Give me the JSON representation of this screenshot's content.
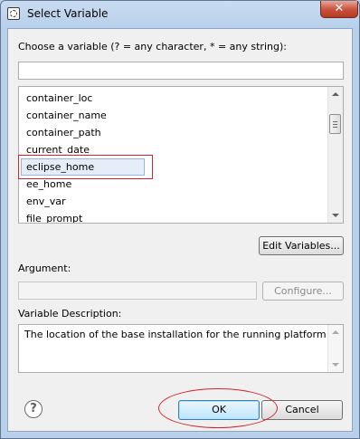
{
  "window": {
    "title": "Select Variable",
    "close_symbol": "✕"
  },
  "filter": {
    "label": "Choose a variable (? = any character, * = any string):",
    "value": ""
  },
  "variables": [
    "container_loc",
    "container_name",
    "container_path",
    "current_date",
    "eclipse_home",
    "ee_home",
    "env_var",
    "file_prompt"
  ],
  "selected_index": 4,
  "buttons": {
    "edit_variables": "Edit Variables...",
    "configure": "Configure...",
    "ok": "OK",
    "cancel": "Cancel"
  },
  "argument": {
    "label": "Argument:",
    "value": ""
  },
  "description": {
    "label": "Variable Description:",
    "text": "The location of the base installation for the running platform"
  },
  "help_symbol": "?",
  "colors": {
    "highlight": "#d4232f"
  }
}
